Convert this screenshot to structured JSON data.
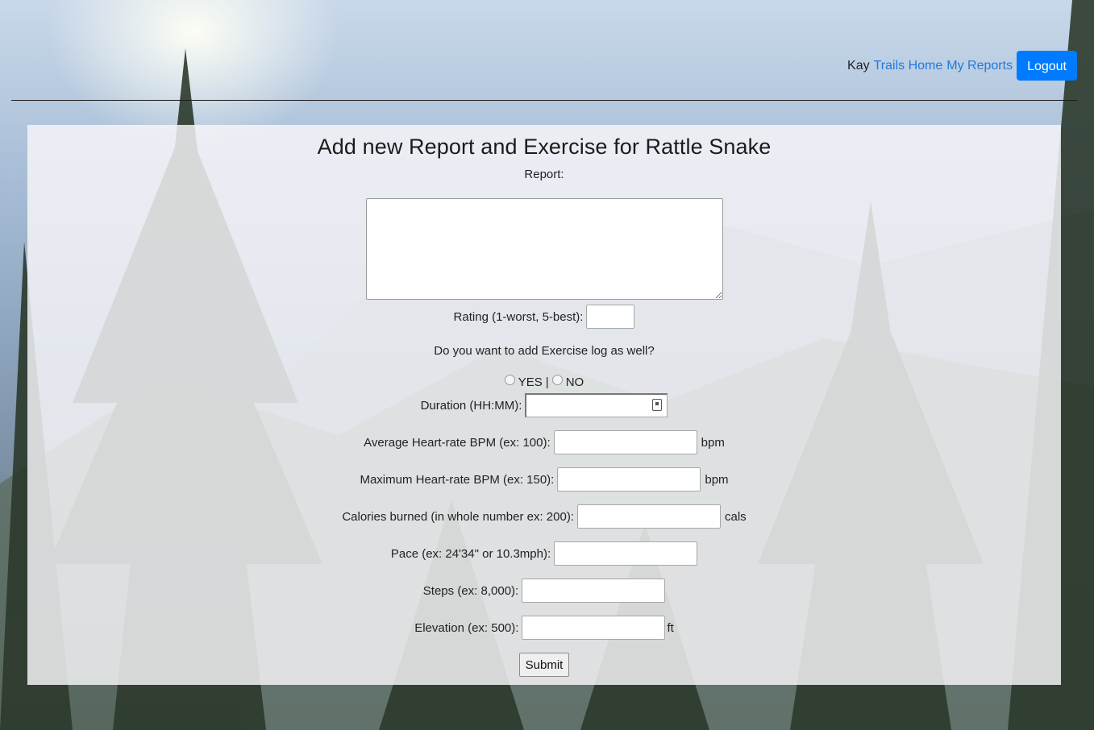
{
  "nav": {
    "username": "Kay",
    "trails_home_label": "Trails Home",
    "my_reports_label": "My Reports",
    "logout_label": "Logout"
  },
  "form": {
    "title": "Add new Report and Exercise for Rattle Snake",
    "report_label": "Report:",
    "report_value": "",
    "rating_label": "Rating (1-worst, 5-best):",
    "rating_value": "",
    "exercise_question": "Do you want to add Exercise log as well?",
    "radio_yes_label": "YES",
    "radio_separator": "|",
    "radio_no_label": "NO",
    "duration_label": "Duration (HH:MM):",
    "duration_value": "",
    "avg_hr_label": "Average Heart-rate BPM (ex: 100):",
    "avg_hr_unit": "bpm",
    "max_hr_label": "Maximum Heart-rate BPM (ex: 150):",
    "max_hr_unit": "bpm",
    "calories_label": "Calories burned (in whole number ex: 200):",
    "calories_unit": "cals",
    "pace_label": "Pace (ex: 24'34\" or 10.3mph):",
    "steps_label": "Steps (ex: 8,000):",
    "elevation_label": "Elevation (ex: 500):",
    "elevation_unit": "ft",
    "submit_label": "Submit"
  }
}
